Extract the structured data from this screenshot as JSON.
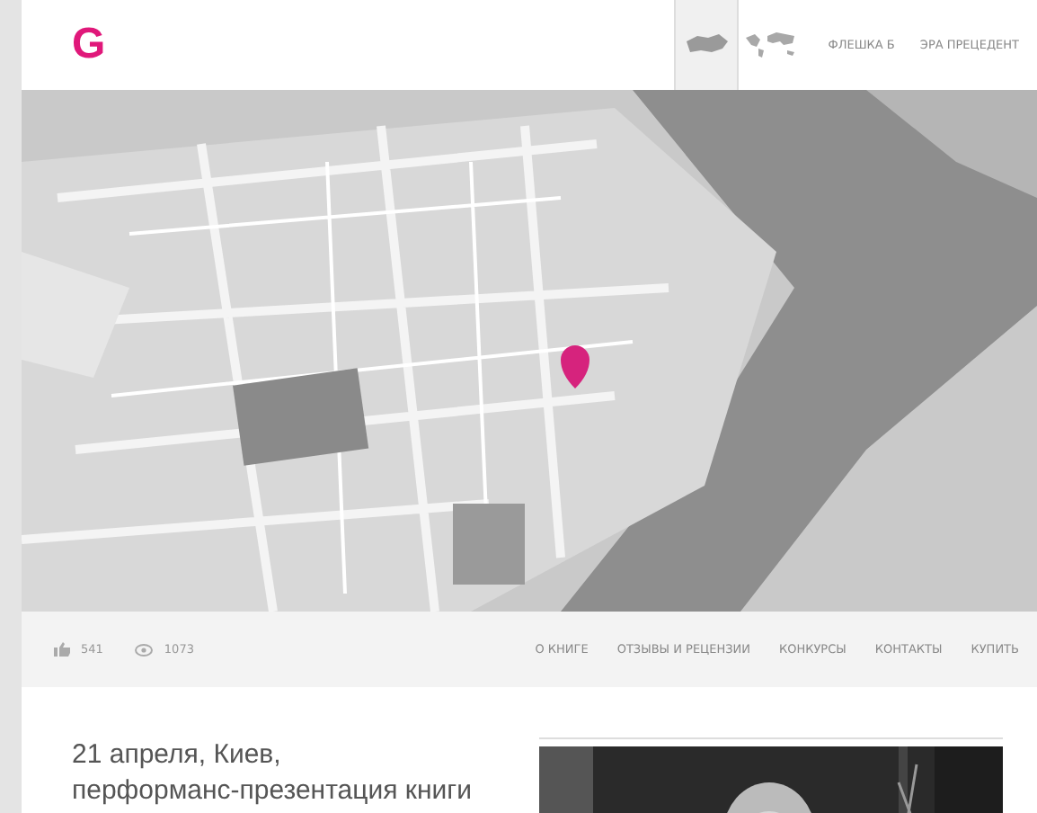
{
  "header": {
    "logo": "G",
    "map_switch": [
      {
        "kind": "country",
        "selected": true
      },
      {
        "kind": "world",
        "selected": false
      }
    ],
    "links": [
      "ФЛЕШКА Б",
      "ЭРА ПРЕЦЕДЕНТ"
    ]
  },
  "stats": {
    "likes": "541",
    "views": "1073"
  },
  "nav": [
    "О КНИГЕ",
    "ОТЗЫВЫ И РЕЦЕНЗИИ",
    "КОНКУРСЫ",
    "КОНТАКТЫ",
    "КУПИТЬ"
  ],
  "article": {
    "lines": [
      "21 апреля, Киев,",
      "перформанс-презентация книги"
    ]
  }
}
